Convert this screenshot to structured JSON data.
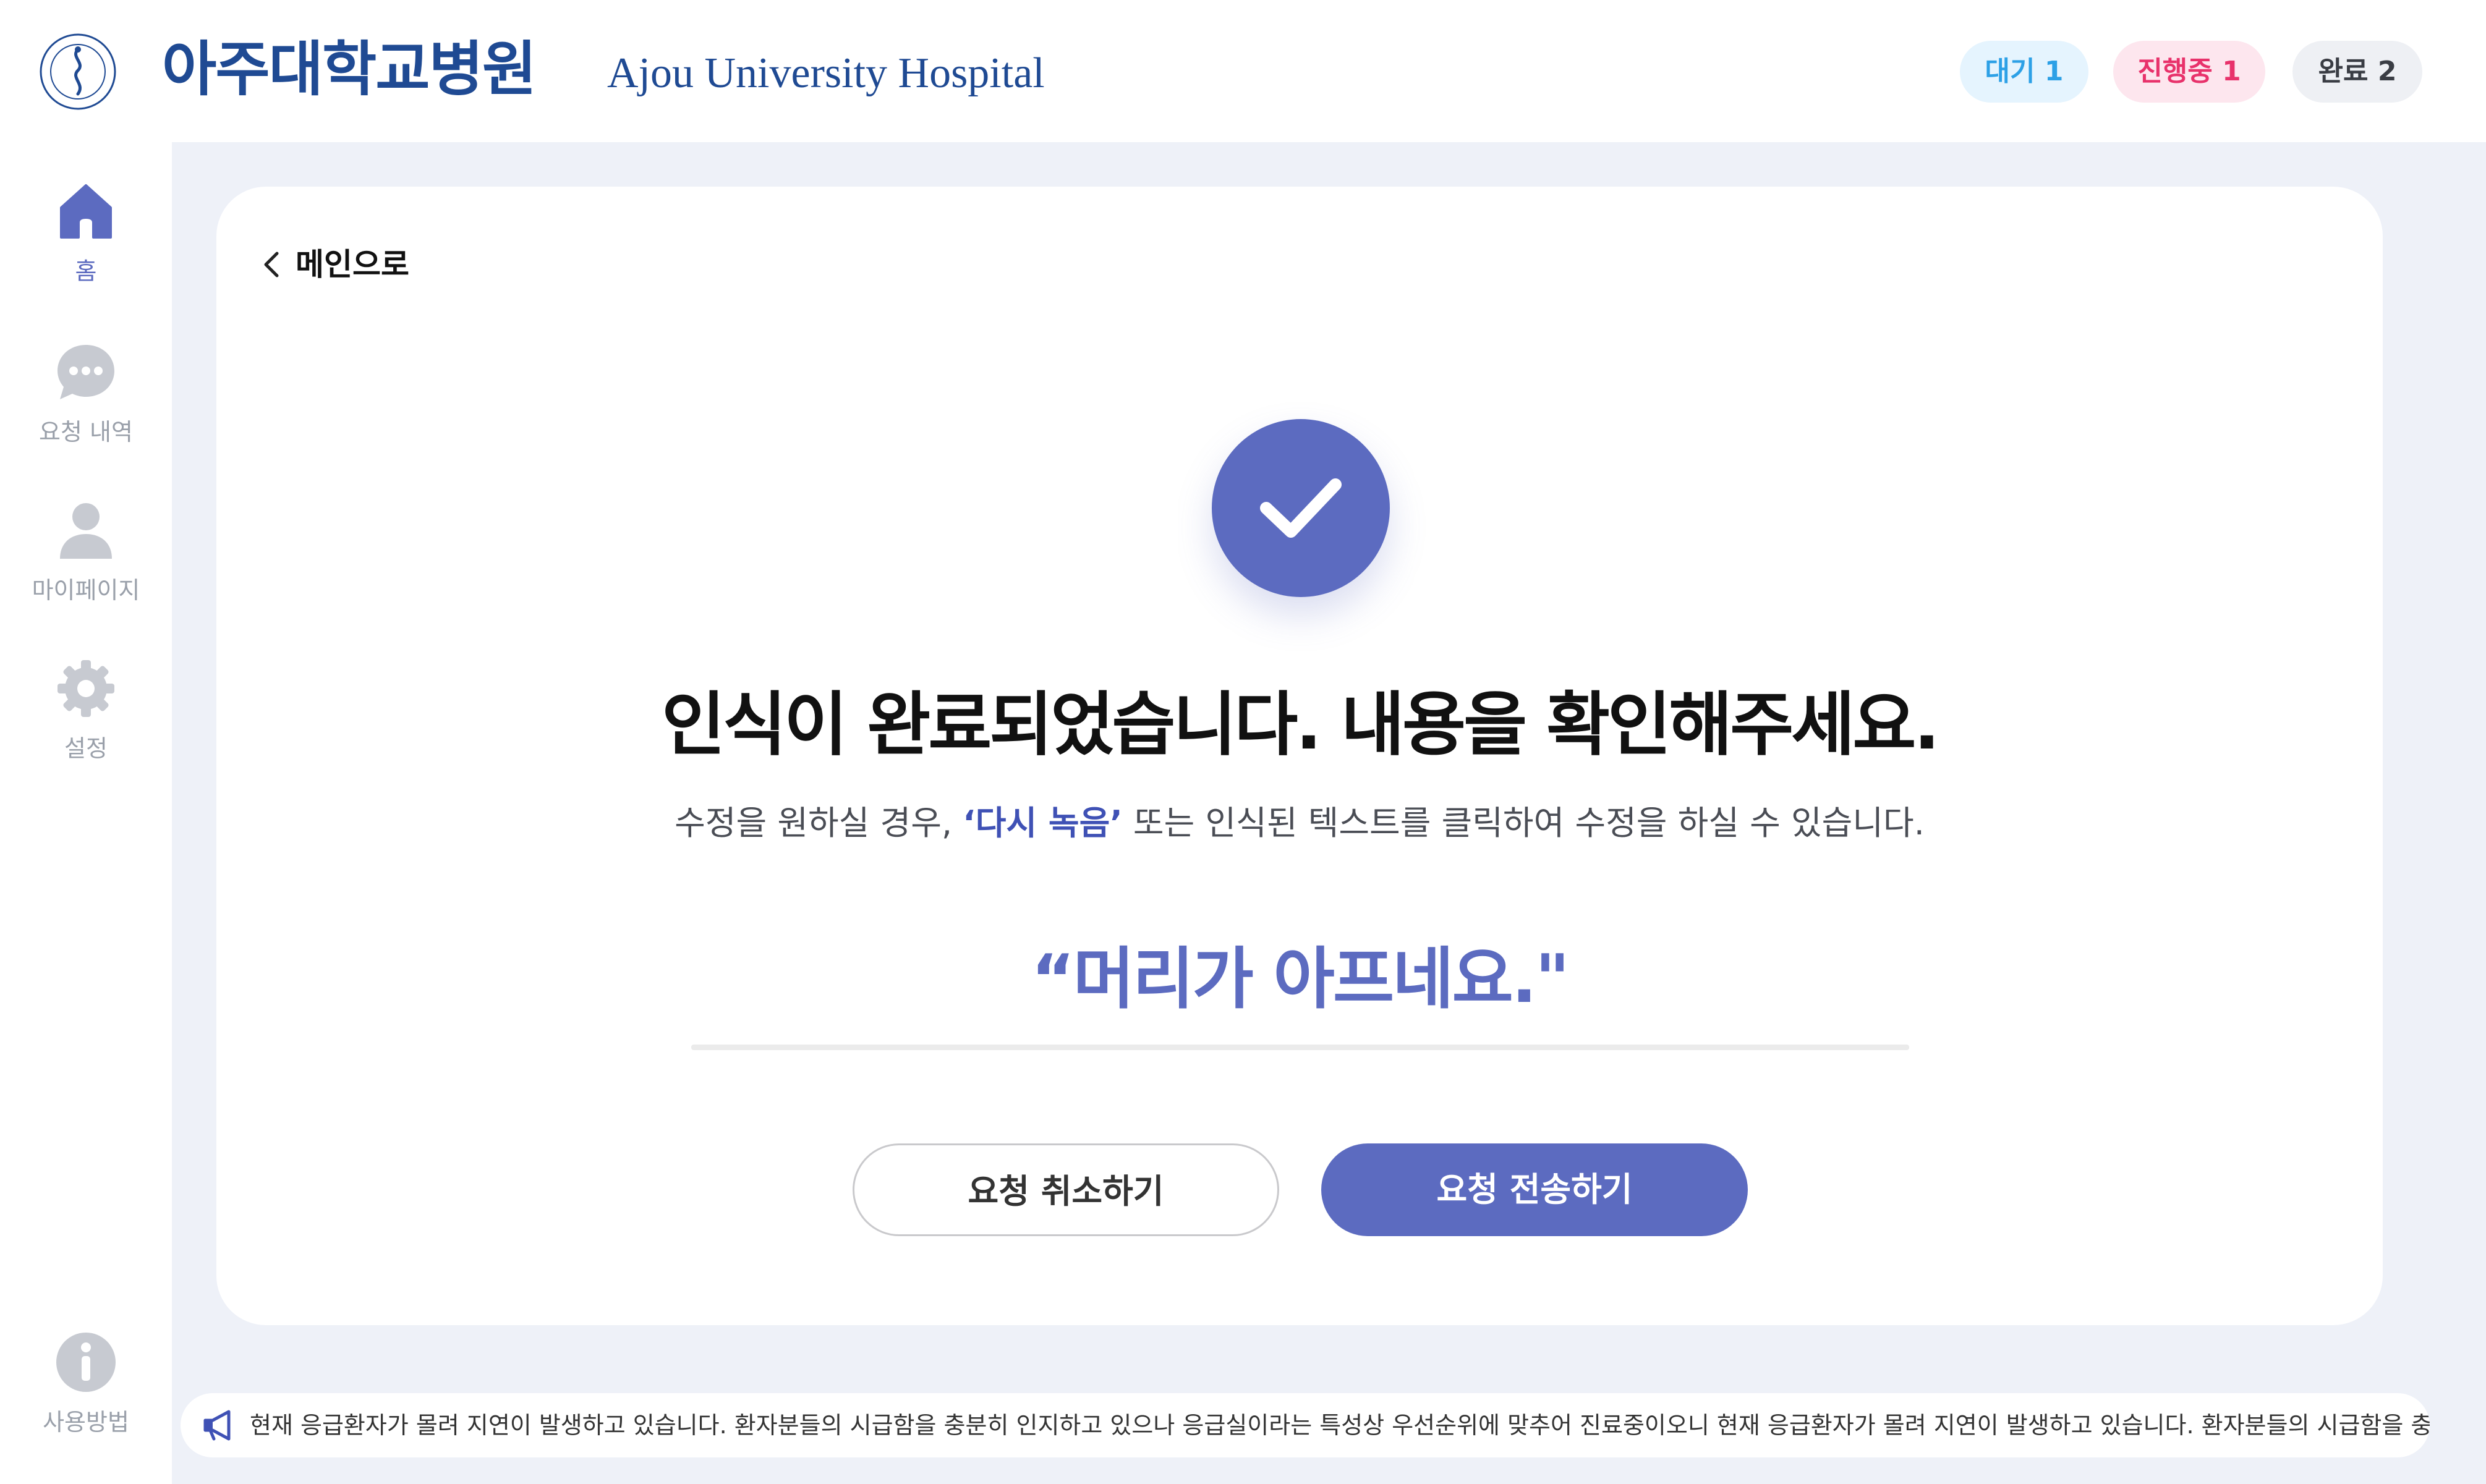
{
  "header": {
    "logo_kr": "아주대학교병원",
    "logo_en": "Ajou University Hospital",
    "status": {
      "waiting": "대기 1",
      "in_progress": "진행중 1",
      "done": "완료 2"
    }
  },
  "sidebar": {
    "items": [
      {
        "label": "홈",
        "icon": "home-icon"
      },
      {
        "label": "요청 내역",
        "icon": "chat-icon"
      },
      {
        "label": "마이페이지",
        "icon": "user-icon"
      },
      {
        "label": "설정",
        "icon": "gear-icon"
      }
    ],
    "help": {
      "label": "사용방법",
      "icon": "info-icon"
    }
  },
  "main": {
    "back_label": "메인으로",
    "title": "인식이 완료되었습니다. 내용을 확인해주세요.",
    "subtitle": {
      "before": "수정을 원하실 경우, ",
      "highlight": "‘다시 녹음’",
      "after": " 또는 인식된 텍스트를 클릭하여 수정을 하실 수 있습니다."
    },
    "recognized_text": "“머리가 아프네요.\"",
    "cancel_label": "요청 취소하기",
    "send_label": "요청 전송하기"
  },
  "notice": {
    "icon": "megaphone-icon",
    "text": "현재 응급환자가 몰려 지연이 발생하고 있습니다. 환자분들의 시급함을 충분히 인지하고 있으나 응급실이라는 특성상 우선순위에 맞추어 진료중이오니 현재 응급환자가 몰려 지연이 발생하고 있습니다. 환자분들의 시급함을 충"
  },
  "colors": {
    "brand": "#1f4a93",
    "accent": "#5c6bc0",
    "waiting": "#2ca0e6",
    "in_progress": "#e8326b",
    "background": "#eef1f8"
  }
}
